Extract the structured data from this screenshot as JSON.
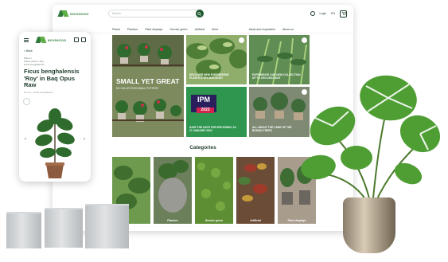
{
  "desktop": {
    "logo_text": "NOVIHOOG",
    "search_placeholder": "Search",
    "header_user": "Login",
    "header_lang": "EN",
    "nav": [
      "Plants",
      "Planters",
      "Plant displays",
      "Service green",
      "Artificial",
      "More"
    ],
    "nav_right": [
      "Ideas and inspiration",
      "About us"
    ],
    "hero": {
      "title": "SMALL YET GREAT",
      "subtitle": "SO COLLECTION SMALL POTTERY"
    },
    "tiles": [
      {
        "caption": "DISCOVER NEW EVERGREENS PLANTS & 10% DISCOUNT"
      },
      {
        "caption": "EXPERIENCE OUR NEW COLLECTION UP TO 30% DISCOUNT"
      },
      {
        "caption": "SAVE THE DATE FOR IPM ESSEN: 24-27 JANUARY 2023",
        "badge_text": "IPM",
        "badge_year": "2023"
      },
      {
        "caption": "ALL ABOUT THE CARE OF THE BONSAI TREES"
      }
    ],
    "categories_title": "Categories",
    "categories": [
      {
        "label": ""
      },
      {
        "label": "Planters"
      },
      {
        "label": "Service green"
      },
      {
        "label": "Artificial"
      },
      {
        "label": "Plant displays"
      }
    ]
  },
  "mobile": {
    "logo_text": "NOVIHOOG",
    "back_label": "< Back",
    "breadcrumb_line1": "Plants /",
    "breadcrumb_line2": "Indoor plants / Fig /",
    "breadcrumb_line3": "Ficus benghalensis",
    "product_title": "Ficus benghalensis 'Roy' in Baq Opus Raw",
    "product_meta": "Item no. • Ficus benghalensis",
    "prev_arrow": "‹",
    "next_arrow": "›"
  },
  "colors": {
    "brand_dark": "#1f5a33",
    "brand_light": "#5fae48",
    "text": "#1f3d2b"
  }
}
